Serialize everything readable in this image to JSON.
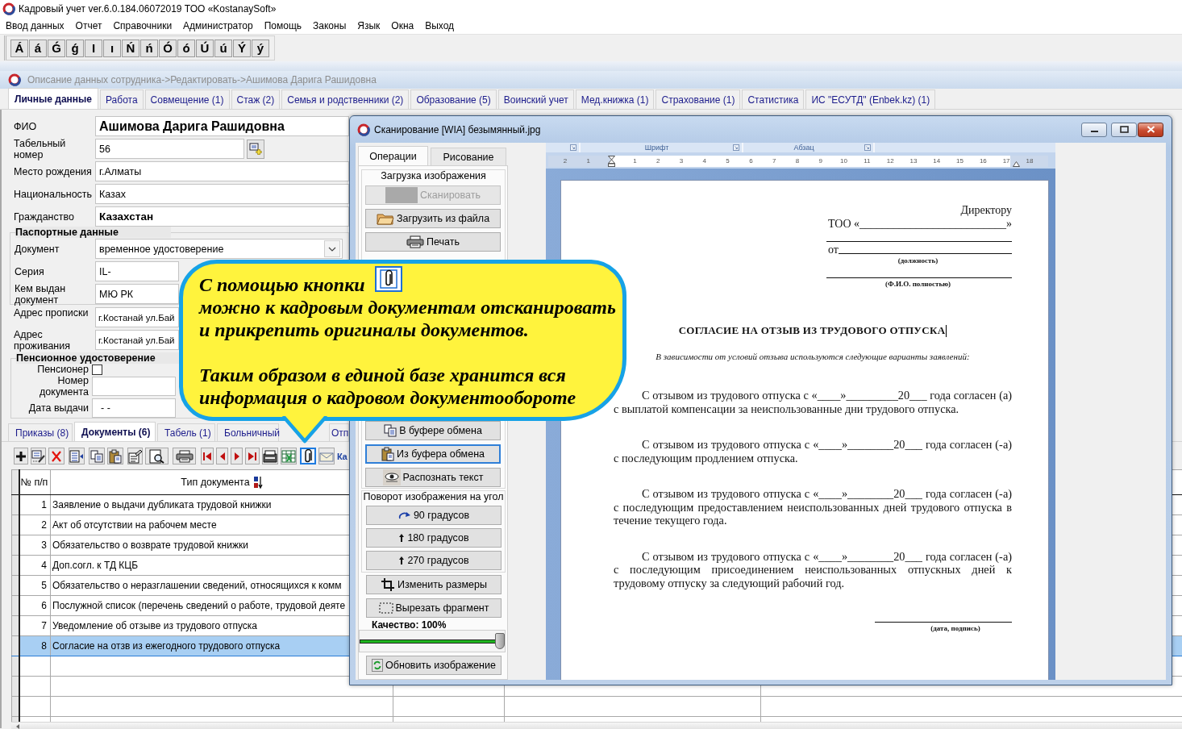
{
  "window": {
    "title": "Кадровый учет ver.6.0.184.06072019 ТОО «KostanaySoft»"
  },
  "menu": [
    "Ввод данных",
    "Отчет",
    "Справочники",
    "Администратор",
    "Помощь",
    "Законы",
    "Язык",
    "Окна",
    "Выход"
  ],
  "letter_keys": [
    "Á",
    "á",
    "Ǵ",
    "ǵ",
    "I",
    "ı",
    "Ń",
    "ń",
    "Ó",
    "ó",
    "Ú",
    "ú",
    "Ý",
    "ý"
  ],
  "employee_window": {
    "breadcrumb": "Описание данных сотрудника->Редактировать->Ашимова Дарига Рашидовна",
    "tabs": [
      {
        "label": "Личные данные",
        "selected": true
      },
      {
        "label": "Работа",
        "selected": false
      },
      {
        "label": "Совмещение (1)",
        "selected": false
      },
      {
        "label": "Стаж (2)",
        "selected": false
      },
      {
        "label": "Семья и родственники (2)",
        "selected": false
      },
      {
        "label": "Образование (5)",
        "selected": false
      },
      {
        "label": "Воинский учет",
        "selected": false
      },
      {
        "label": "Мед.книжка (1)",
        "selected": false
      },
      {
        "label": "Страхование (1)",
        "selected": false
      },
      {
        "label": "Статистика",
        "selected": false
      },
      {
        "label": "ИС \"ЕСУТД\" (Enbek.kz) (1)",
        "selected": false
      }
    ]
  },
  "personal": {
    "full_name": {
      "label": "ФИО",
      "value": "Ашимова Дарига Рашидовна"
    },
    "personnel_number": {
      "label": "Табельный номер",
      "value": "56"
    },
    "birthplace": {
      "label": "Место рождения",
      "value": "г.Алматы"
    },
    "nationality": {
      "label": "Национальность",
      "value": "Казах"
    },
    "citizenship": {
      "label": "Гражданство",
      "value": "Казахстан"
    }
  },
  "passport": {
    "title": "Паспортные данные",
    "document": {
      "label": "Документ",
      "value": "временное удостоверение"
    },
    "series": {
      "label": "Серия",
      "value": "IL-"
    },
    "issued_by": {
      "label": "Кем выдан документ",
      "value": "МЮ РК"
    }
  },
  "registration_address": {
    "label": "Адрес прописки",
    "value": "г.Костанай ул.Бай"
  },
  "residence_address": {
    "label": "Адрес проживания",
    "value": "г.Костанай ул.Бай"
  },
  "pension": {
    "title": "Пенсионное удостоверение",
    "pensioner": {
      "label": "Пенсионер",
      "checked": false
    },
    "number": {
      "label": "Номер документа"
    },
    "issue_date": {
      "label": "Дата выдачи",
      "value": "- -"
    }
  },
  "document_tabs": [
    {
      "label": "Приказы (8)",
      "selected": false
    },
    {
      "label": "Документы (6)",
      "selected": true
    },
    {
      "label": "Табель (1)",
      "selected": false
    },
    {
      "label": "Больничный",
      "selected": false
    },
    {
      "label": "Отп",
      "selected": false
    }
  ],
  "documents_toolbar": {
    "buttons": [
      {
        "selected": false
      },
      {
        "selected": false
      },
      {
        "selected": false
      },
      {
        "selected": false
      },
      {
        "selected": false
      },
      {
        "selected": false
      },
      {
        "selected": false
      },
      {
        "selected": false
      },
      {
        "selected": false
      },
      {
        "selected": false
      },
      {
        "selected": false
      },
      {
        "selected": false
      },
      {
        "selected": false
      },
      {
        "selected": false
      },
      {
        "selected": false
      },
      {
        "selected": true
      },
      {
        "selected": false
      }
    ],
    "trailing_text": "Ка"
  },
  "documents_table": {
    "columns": [
      "№ п/п",
      "Тип документа"
    ],
    "rows": [
      {
        "number": "1",
        "type": "Заявление о выдачи дубликата трудовой книжки",
        "selected": false
      },
      {
        "number": "2",
        "type": "Акт об отсутствии на рабочем месте",
        "selected": false
      },
      {
        "number": "3",
        "type": "Обязательство о возврате трудовой книжки",
        "selected": false
      },
      {
        "number": "4",
        "type": "Доп.согл. к ТД КЦБ",
        "selected": false
      },
      {
        "number": "5",
        "type": "Обязательство о неразглашении сведений, относящихся к комм",
        "selected": false
      },
      {
        "number": "6",
        "type": "Послужной список (перечень сведений о работе, трудовой деяте",
        "selected": false
      },
      {
        "number": "7",
        "type": "Уведомление об отзыве из трудового отпуска",
        "selected": false
      },
      {
        "number": "8",
        "type": "Согласие на отзв из ежегодного трудового отпуска",
        "selected": true
      }
    ]
  },
  "scanner": {
    "title": "Сканирование [WIA] безымянный.jpg",
    "tabs": [
      {
        "label": "Операции",
        "selected": true
      },
      {
        "label": "Рисование",
        "selected": false
      }
    ],
    "load_group": {
      "title": "Загрузка изображения",
      "buttons": [
        {
          "label": "Сканировать",
          "disabled": true,
          "focused": false
        },
        {
          "label": "Загрузить из файла",
          "disabled": false,
          "focused": false
        },
        {
          "label": "Печать",
          "disabled": false,
          "focused": false
        }
      ]
    },
    "clipboard_buttons": [
      {
        "label": "В буфере обмена",
        "disabled": false,
        "focused": false
      },
      {
        "label": "Из буфера обмена",
        "disabled": false,
        "focused": true
      },
      {
        "label": "Распознать текст",
        "disabled": false,
        "focused": false
      }
    ],
    "rotate_group": {
      "title": "Поворот изображения на угол",
      "buttons": [
        {
          "label": "90 градусов",
          "disabled": false,
          "focused": false
        },
        {
          "label": "180 градусов",
          "disabled": false,
          "focused": false
        },
        {
          "label": "270 градусов",
          "disabled": false,
          "focused": false
        }
      ]
    },
    "tool_buttons": [
      {
        "label": "Изменить размеры",
        "disabled": false,
        "focused": false
      },
      {
        "label": "Вырезать фрагмент",
        "disabled": false,
        "focused": false
      }
    ],
    "quality": {
      "label": "Качество: 100%",
      "level": 1
    },
    "refresh_button": {
      "label": "Обновить изображение"
    }
  },
  "scanned_document": {
    "ribbon_groups": [
      "Шрифт",
      "Абзац"
    ],
    "ruler": {
      "left_numbers": [
        "2",
        "1"
      ],
      "right_numbers": [
        "1",
        "2",
        "3",
        "4",
        "5",
        "6",
        "7",
        "8",
        "9",
        "10",
        "11",
        "12",
        "13",
        "14",
        "15",
        "16",
        "17",
        "18"
      ]
    },
    "page": {
      "addressee": "Директору",
      "company_line": "ТОО «__________________________»",
      "from_label": "от",
      "position_caption": "(должность)",
      "name_caption": "(Ф.И.О. полностью)",
      "title": "СОГЛАСИЕ НА ОТЗЫВ ИЗ ТРУДОВОГО ОТПУСКА",
      "subtitle": "В зависимости от условий отзыва используются следующие варианты заявлений:",
      "paragraphs": [
        "С отзывом из трудового отпуска с «____»_________20___ года согласен (а) с выплатой компенсации за неиспользованные дни трудового отпуска.",
        "С отзывом из трудового отпуска с «____»________20___ года согласен (-а) с последующим продлением отпуска.",
        "С отзывом из трудового отпуска с «____»________20___ года согласен (-а) с последующим предоставлением неиспользованных дней трудового отпуска в течение текущего года.",
        "С отзывом из трудового отпуска с «____»________20___ года согласен (-а) с последующим присоединением неиспользованных отпускных дней к трудовому отпуску за следующий рабочий год."
      ],
      "signature_caption": "(дата, подпись)"
    }
  },
  "callout": {
    "text_before_icon": "С помощью кнопки",
    "text_after_icon": "можно к кадровым документам отсканировать и прикрепить оригиналы документов.",
    "conclusion": "Таким образом в единой базе хранится вся информация о кадровом документообороте"
  }
}
